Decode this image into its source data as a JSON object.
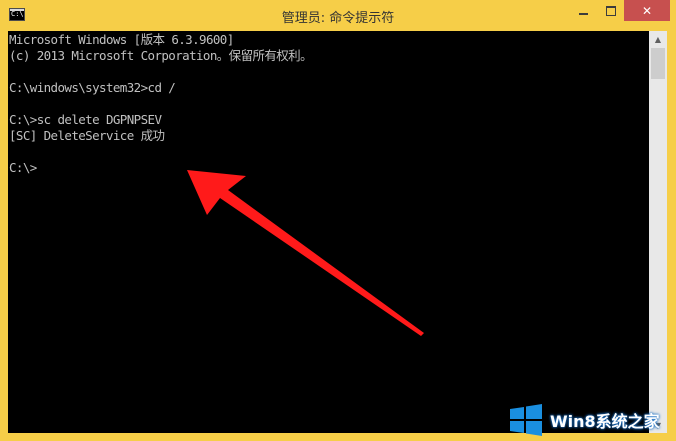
{
  "window": {
    "title": "管理员: 命令提示符",
    "icon_label": "C:\\",
    "controls": {
      "close_glyph": "✕"
    }
  },
  "console": {
    "lines": [
      "Microsoft Windows [版本 6.3.9600]",
      "(c) 2013 Microsoft Corporation。保留所有权利。",
      "",
      "C:\\windows\\system32>cd /",
      "",
      "C:\\>sc delete DGPNPSEV",
      "[SC] DeleteService 成功",
      "",
      "C:\\>"
    ],
    "text_color": "#c0c0c0",
    "background": "#000000"
  },
  "scrollbar": {
    "up_icon": "▲",
    "down_icon": "▼"
  },
  "annotation": {
    "arrow_color": "#ff1a1a"
  },
  "watermark": {
    "text": "Win8系统之家",
    "logo_color": "#1a8fe0"
  },
  "colors": {
    "frame": "#f6ce48",
    "close_button": "#c7504f"
  }
}
